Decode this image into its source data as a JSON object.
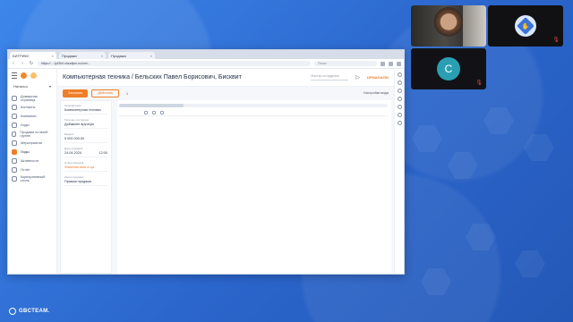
{
  "browser": {
    "tabs": [
      {
        "label": "БИТРИКС",
        "active": true
      },
      {
        "label": "Продажи",
        "active": false
      },
      {
        "label": "Продажа",
        "active": false
      }
    ],
    "url": "https://....1pf2b0.cloudfpm.ru/crm/...",
    "search_placeholder": "Поиск"
  },
  "sidebar": {
    "user": "Наталья",
    "items": [
      {
        "label": "Домашняя страница",
        "icon": "home-icon",
        "active": false
      },
      {
        "label": "Контакты",
        "icon": "contacts-icon",
        "active": false
      },
      {
        "label": "Компании",
        "icon": "companies-icon",
        "active": false
      },
      {
        "label": "Лиды",
        "icon": "leads-icon",
        "active": false
      },
      {
        "label": "Продажи по моей группе",
        "icon": "sales-group-icon",
        "active": false
      },
      {
        "label": "Мероприятия",
        "icon": "events-icon",
        "active": false
      },
      {
        "label": "Лиды",
        "icon": "leads-active-icon",
        "active": true
      },
      {
        "label": "Активности",
        "icon": "activities-icon",
        "active": false
      },
      {
        "label": "Отчёт",
        "icon": "report-icon",
        "active": false
      },
      {
        "label": "Корпоративный стиль",
        "icon": "style-icon",
        "active": false
      }
    ]
  },
  "header": {
    "title": "Компьютерная техника / Бельских Павел Борисович, Бисквит",
    "find_placeholder": "Мастер сотрудника",
    "brand": "DFMAGAZIN"
  },
  "actions": {
    "primary": "Записать",
    "secondary": "Действия",
    "count": "1",
    "settings": "Настройки вида"
  },
  "card": {
    "fields": [
      {
        "label": "Направление",
        "value": "Компьютерная техника",
        "link": false
      },
      {
        "label": "Текущее состояние",
        "value": "Добавлен вручную",
        "link": false
      },
      {
        "label": "Бюджет",
        "value": "5 000 000,00",
        "link": false
      },
      {
        "label": "Дата создания",
        "value": "24.04.2024",
        "extra": "12:00",
        "link": false
      },
      {
        "label": "Ответственный",
        "value": "Фамилия имя отца",
        "link": true
      },
      {
        "label": "Канал продажи",
        "value": "Прямая продажа",
        "link": false
      }
    ]
  },
  "timeline": {
    "progress": 0.24
  },
  "video": {
    "avatar_letter": "C"
  },
  "footer": {
    "brand": "GBCTEAM."
  }
}
